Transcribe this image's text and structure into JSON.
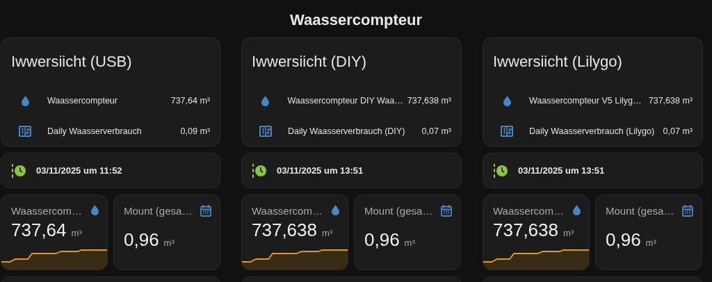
{
  "title": "Waassercompteur",
  "columns": [
    {
      "overview": {
        "title": "Iwwersiicht (USB)",
        "rows": [
          {
            "kind": "water",
            "name": "Waassercompteur",
            "value": "737,64 m³"
          },
          {
            "kind": "counter",
            "name": "Daily Waasserverbrauch",
            "value": "0,09 m³"
          }
        ]
      },
      "timestamp": "03/11/2025 um 11:52",
      "tiles": [
        {
          "kind": "graph",
          "name": "Waassercom…",
          "value": "737,64",
          "unit": "m³"
        },
        {
          "kind": "calendar",
          "name": "Mount (gesa…",
          "value": "0,96",
          "unit": "m³"
        }
      ]
    },
    {
      "overview": {
        "title": "Iwwersiicht (DIY)",
        "rows": [
          {
            "kind": "water",
            "name": "Waassercompteur DIY Waa…",
            "value": "737,638 m³"
          },
          {
            "kind": "counter",
            "name": "Daily Waasserverbrauch (DIY)",
            "value": "0,07 m³"
          }
        ]
      },
      "timestamp": "03/11/2025 um 13:51",
      "tiles": [
        {
          "kind": "graph",
          "name": "Waassercom…",
          "value": "737,638",
          "unit": "m³"
        },
        {
          "kind": "calendar",
          "name": "Mount (gesa…",
          "value": "0,96",
          "unit": "m³"
        }
      ]
    },
    {
      "overview": {
        "title": "Iwwersiicht (Lilygo)",
        "rows": [
          {
            "kind": "water",
            "name": "Waassercompteur V5 Lilyg…",
            "value": "737,638 m³"
          },
          {
            "kind": "counter",
            "name": "Daily Waasserverbrauch (Lilygo)",
            "value": "0,07 m³"
          }
        ]
      },
      "timestamp": "03/11/2025 um 13:51",
      "tiles": [
        {
          "kind": "graph",
          "name": "Waassercom…",
          "value": "737,638",
          "unit": "m³"
        },
        {
          "kind": "calendar",
          "name": "Mount (gesa…",
          "value": "0,96",
          "unit": "m³"
        }
      ]
    }
  ]
}
